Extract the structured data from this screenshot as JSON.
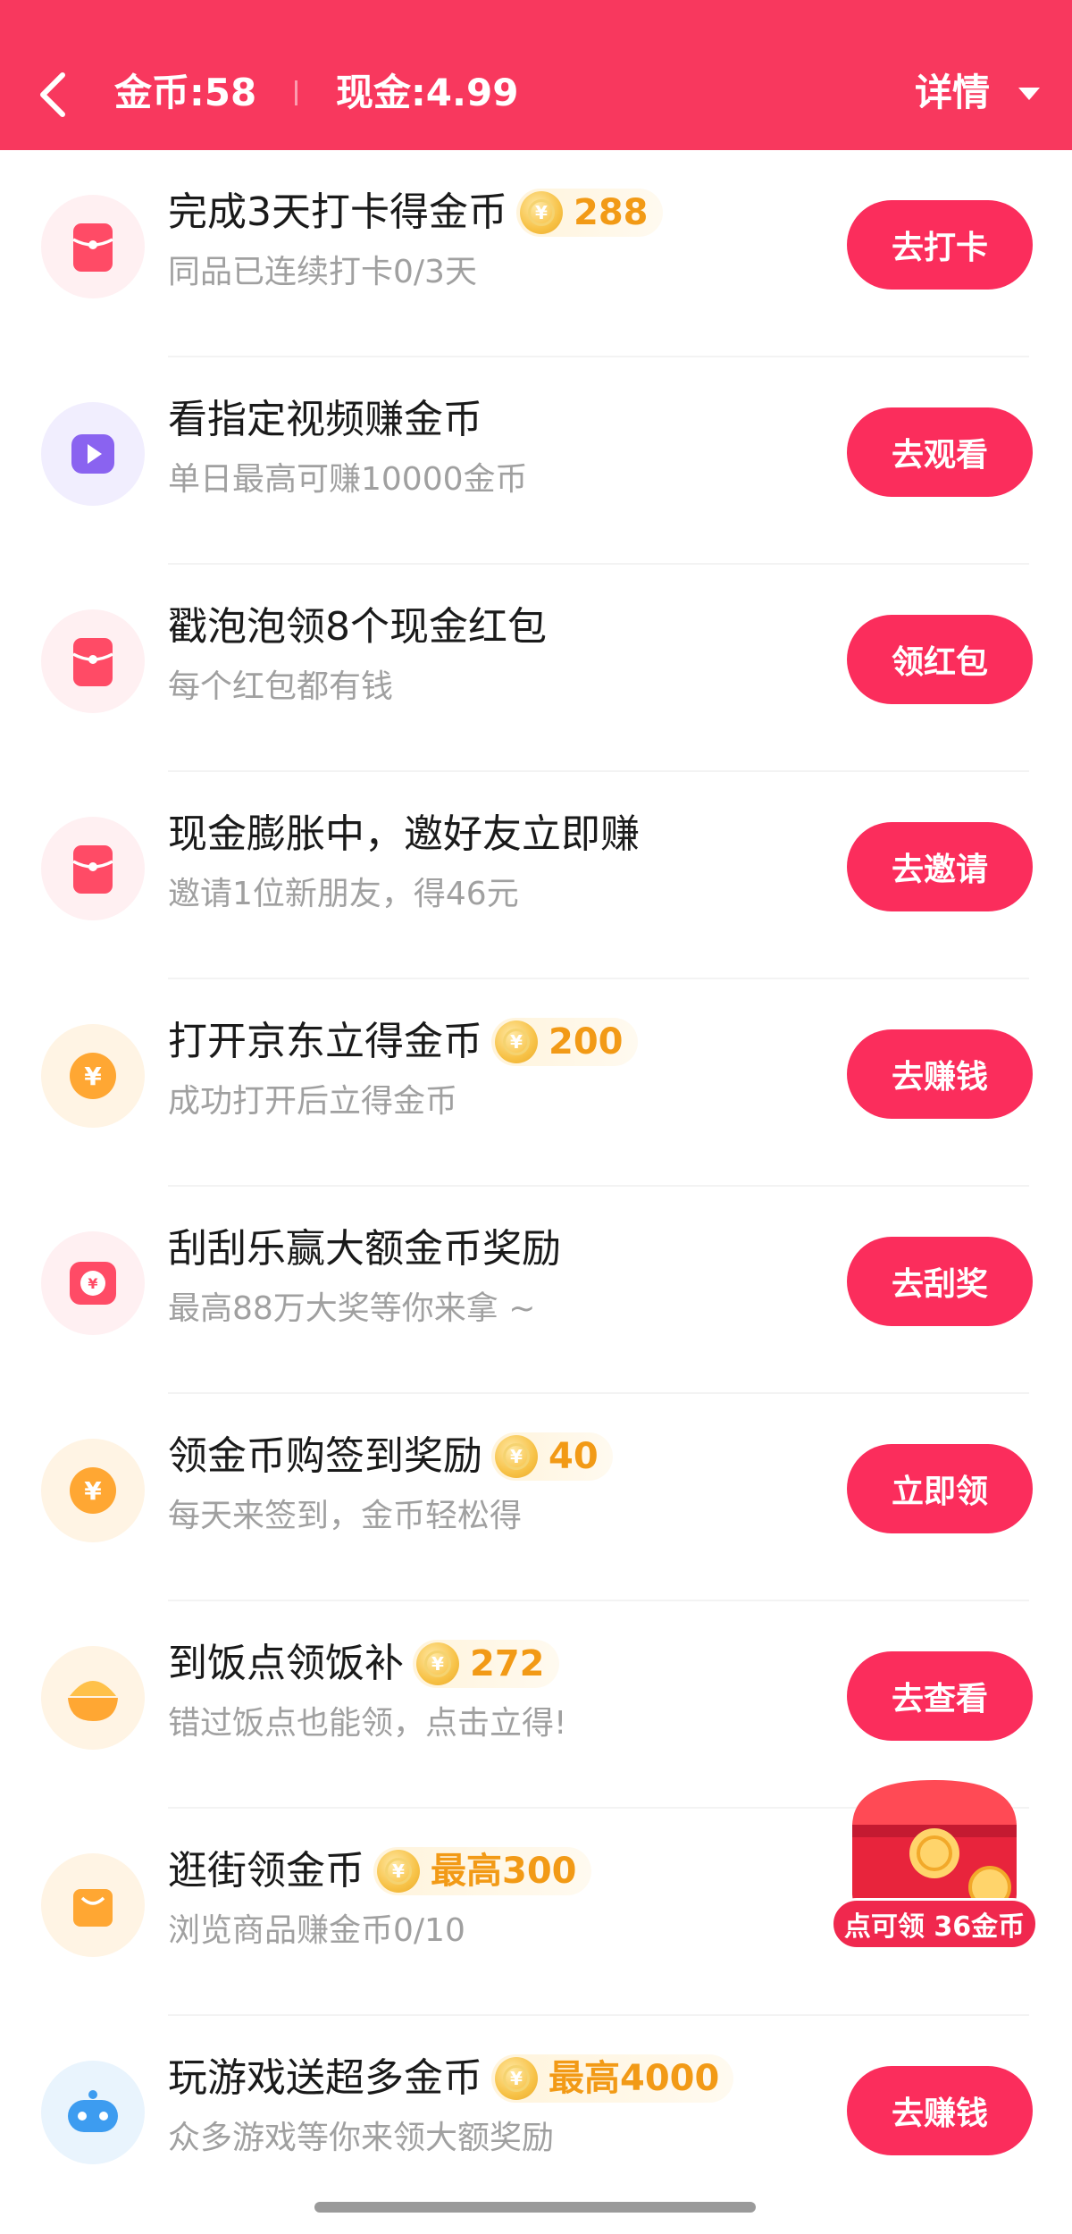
{
  "header": {
    "coin_label": "金币:58",
    "cash_label": "现金:4.99",
    "detail_label": "详情"
  },
  "tasks": [
    {
      "icon": "red-envelope-icon",
      "title": "完成3天打卡得金币",
      "badge": "288",
      "subtitle": "同品已连续打卡0/3天",
      "button": "去打卡"
    },
    {
      "icon": "video-play-icon",
      "title": "看指定视频赚金币",
      "badge": null,
      "subtitle": "单日最高可赚10000金币",
      "button": "去观看"
    },
    {
      "icon": "red-envelope-icon",
      "title": "戳泡泡领8个现金红包",
      "badge": null,
      "subtitle": "每个红包都有钱",
      "button": "领红包"
    },
    {
      "icon": "red-envelope-icon",
      "title": "现金膨胀中，邀好友立即赚",
      "badge": null,
      "subtitle": "邀请1位新朋友，得46元",
      "button": "去邀请"
    },
    {
      "icon": "yen-coin-icon",
      "title": "打开京东立得金币",
      "badge": "200",
      "subtitle": "成功打开后立得金币",
      "button": "去赚钱"
    },
    {
      "icon": "scratch-card-icon",
      "title": "刮刮乐赢大额金币奖励",
      "badge": null,
      "subtitle": "最高88万大奖等你来拿 ~",
      "button": "去刮奖"
    },
    {
      "icon": "yen-coin-icon",
      "title": "领金币购签到奖励",
      "badge": "40",
      "subtitle": "每天来签到，金币轻松得",
      "button": "立即领"
    },
    {
      "icon": "rice-bowl-icon",
      "title": "到饭点领饭补",
      "badge": "272",
      "subtitle": "错过饭点也能领，点击立得!",
      "button": "去查看"
    },
    {
      "icon": "shopping-bag-icon",
      "title": "逛街领金币",
      "badge": "最高300",
      "subtitle": "浏览商品赚金币0/10",
      "button": null
    },
    {
      "icon": "game-controller-icon",
      "title": "玩游戏送超多金币",
      "badge": "最高4000",
      "subtitle": "众多游戏等你来领大额奖励",
      "button": "去赚钱"
    }
  ],
  "floating_reward": {
    "label": "点可领 36金币"
  },
  "colors": {
    "brand": "#f8385e",
    "button": "#fb2d5c",
    "coin_text": "#f29a16"
  }
}
